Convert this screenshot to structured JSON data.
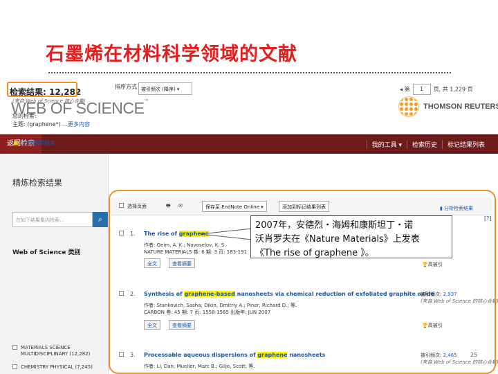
{
  "slide": {
    "title": "石墨烯在材料科学领域的文献",
    "page_number": "25"
  },
  "header": {
    "logo": "WEB OF SCIENCE",
    "logo_mark": "™",
    "brand": "THOMSON REUTERS"
  },
  "nav": {
    "back": "返回检索",
    "menu": [
      "我的工具 ▾",
      "检索历史",
      "标记结果列表"
    ]
  },
  "left_panel": {
    "result_count": "检索结果: 12,282",
    "result_source": "(来自 Web of Science 核心合集)",
    "your_search_label": "您的检索:",
    "your_search_query": "主题: (graphene*) ",
    "your_search_more": "...更多内容",
    "alert": "创建跟踪服务",
    "refine_heading": "精炼检索结果",
    "refine_placeholder": "在如下结果集内检索...",
    "category_heading": "Web of Science 类别",
    "categories": [
      "MATERIALS SCIENCE",
      "MULTIDISCIPLINARY (12,282)",
      "CHEMISTRY PHYSICAL (7,245)"
    ]
  },
  "sortbar": {
    "label": "排序方式",
    "selected": "被引频次 (降序)",
    "page_label": "第",
    "page_value": "1",
    "page_total": "页, 共 1,229 页"
  },
  "toolbar": {
    "select_page": "选择页面",
    "save_to": "保存至 EndNote Online",
    "add_to_list": "添加到标记结果列表",
    "analyze": "分析检索结果",
    "help": "[?]"
  },
  "records": [
    {
      "num": "1.",
      "title_pre": "The rise of ",
      "title_hl": "graphene",
      "title_post": "",
      "authors": "作者: Geim, A. K.; Novoselov, K. S.",
      "source": "NATURE MATERIALS 卷: 6 期: 3 页: 183-191",
      "btn1": "全文",
      "btn2": "查看摘要",
      "cite_label": "被引频次:",
      "cite_value": "",
      "cite_src": "(来自 Web of Science 的核心合集)",
      "trophy": "高被引"
    },
    {
      "num": "2.",
      "title_pre": "Synthesis of ",
      "title_hl": "graphene-based",
      "title_post": " nanosheets via chemical reduction of exfoliated graphite oxide",
      "authors": "作者: Stankovich, Sasha; Dikin, Dmitriy A.; Piner, Richard D.; 等.",
      "source": "CARBON 卷: 45 期: 7 页: 1558-1565 出版年: JUN 2007",
      "btn1": "全文",
      "btn2": "查看摘要",
      "cite_label": "被引频次:",
      "cite_value": "2,937",
      "cite_src": "(来自 Web of Science 的核心合集)",
      "trophy": "高被引"
    },
    {
      "num": "3.",
      "title_pre": "Processable aqueous dispersions of ",
      "title_hl": "graphene",
      "title_post": " nanosheets",
      "authors": "作者: Li, Dan; Mueller, Marc B.; Gilje, Scott; 等.",
      "source": "",
      "btn1": "",
      "btn2": "",
      "cite_label": "被引频次:",
      "cite_value": "2,465",
      "cite_src": "(来自 Web of Science 的核心合集)",
      "trophy": ""
    }
  ],
  "callout": {
    "line1": "2007年，安德烈・海姆和康斯坦丁・诺",
    "line2": "沃肖罗夫在《Nature Materials》上发表",
    "line3": "《The rise of graphene 》。"
  },
  "colors": {
    "title_red": "#e0201f",
    "nav_bar": "#6b1b1b",
    "highlight_frame": "#e9912d",
    "link_blue": "#1b57a6"
  }
}
